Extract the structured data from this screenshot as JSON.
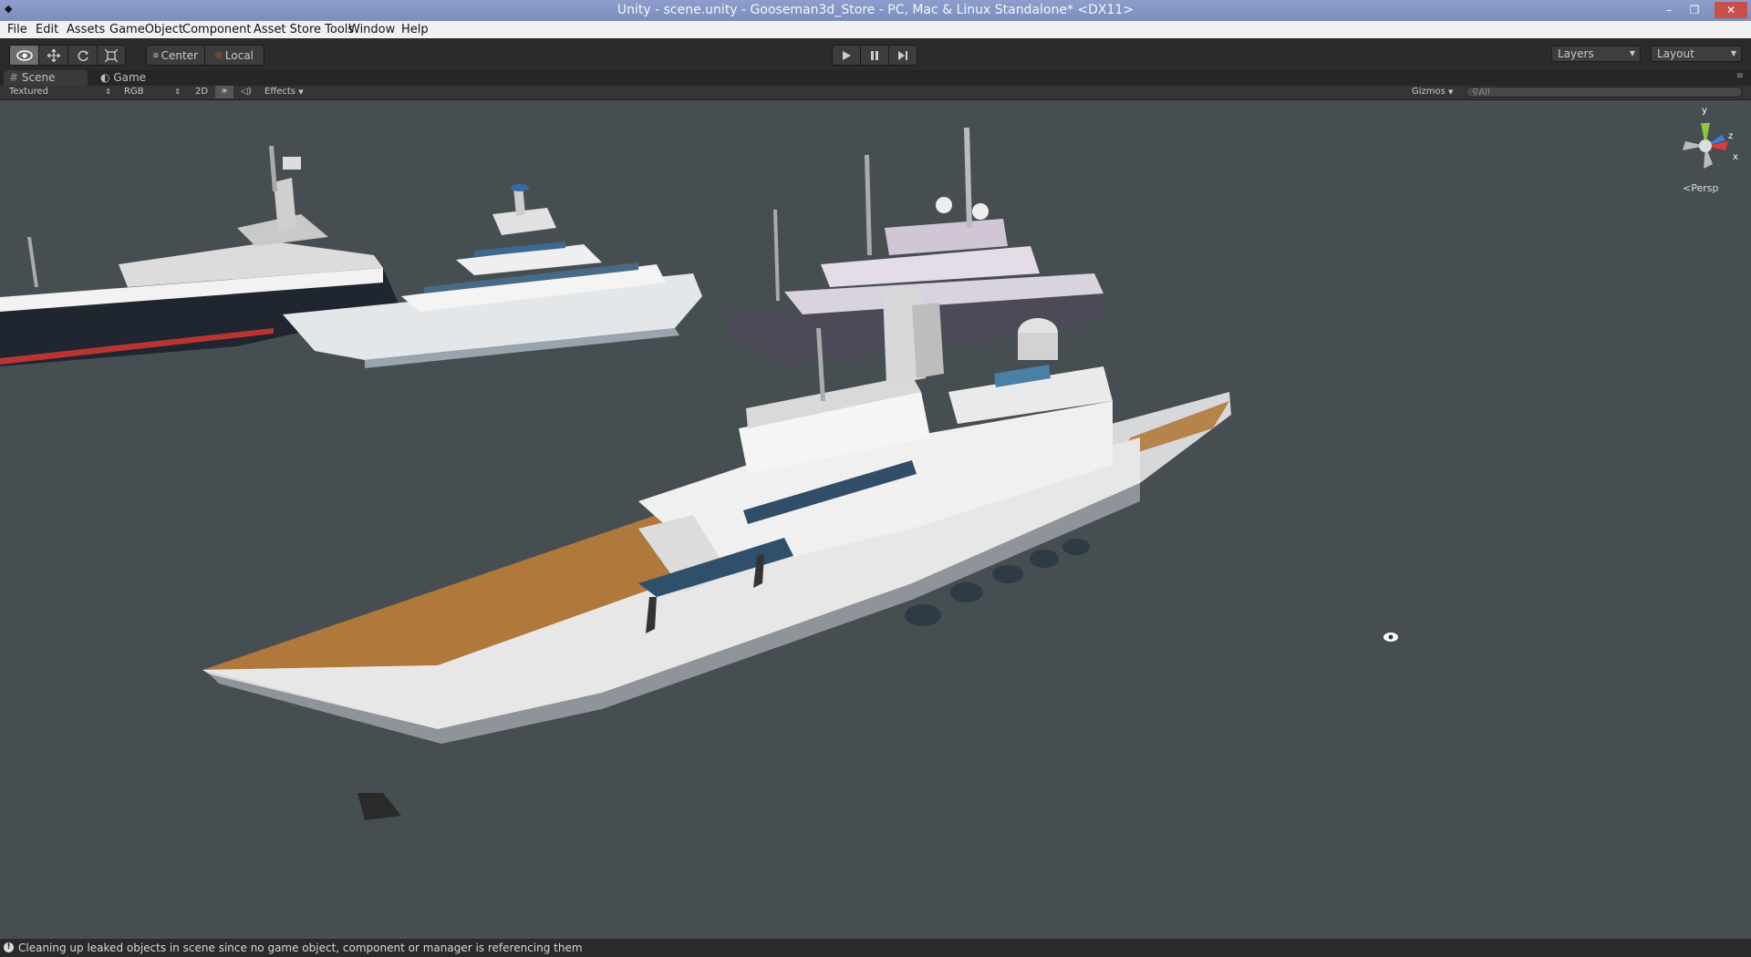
{
  "window": {
    "title": "Unity - scene.unity - Gooseman3d_Store - PC, Mac & Linux Standalone* <DX11>",
    "controls": [
      "–",
      "❐",
      "✕"
    ]
  },
  "menu": [
    "File",
    "Edit",
    "Assets",
    "GameObject",
    "Component",
    "Asset Store Tools",
    "Window",
    "Help"
  ],
  "toolbar": {
    "tools": [
      "view-tool",
      "move-tool",
      "rotate-tool",
      "scale-tool"
    ],
    "pivot_mode": "Center",
    "pivot_rotation": "Local",
    "layers_label": "Layers",
    "layout_label": "Layout"
  },
  "tabs": [
    {
      "label": "Scene",
      "icon": "hash-icon",
      "active": true
    },
    {
      "label": "Game",
      "icon": "pacman-icon",
      "active": false
    }
  ],
  "scene_options": {
    "render_mode": "Textured",
    "color_mode": "RGB",
    "toggle_2d": "2D",
    "effects": "Effects",
    "gizmos": "Gizmos",
    "search_placeholder": "All"
  },
  "gizmo": {
    "y_label": "y",
    "z_label": "z",
    "x_label": "x",
    "projection": "Persp"
  },
  "status": {
    "message": "Cleaning up leaked objects in scene since no game object, component or manager is referencing them"
  },
  "colors": {
    "viewport": "#474e52",
    "toolbar": "#2b2b2b",
    "titlebar": "#8e9ecc",
    "deck_wood": "#b0793b",
    "hull_white": "#e7e7e7"
  }
}
